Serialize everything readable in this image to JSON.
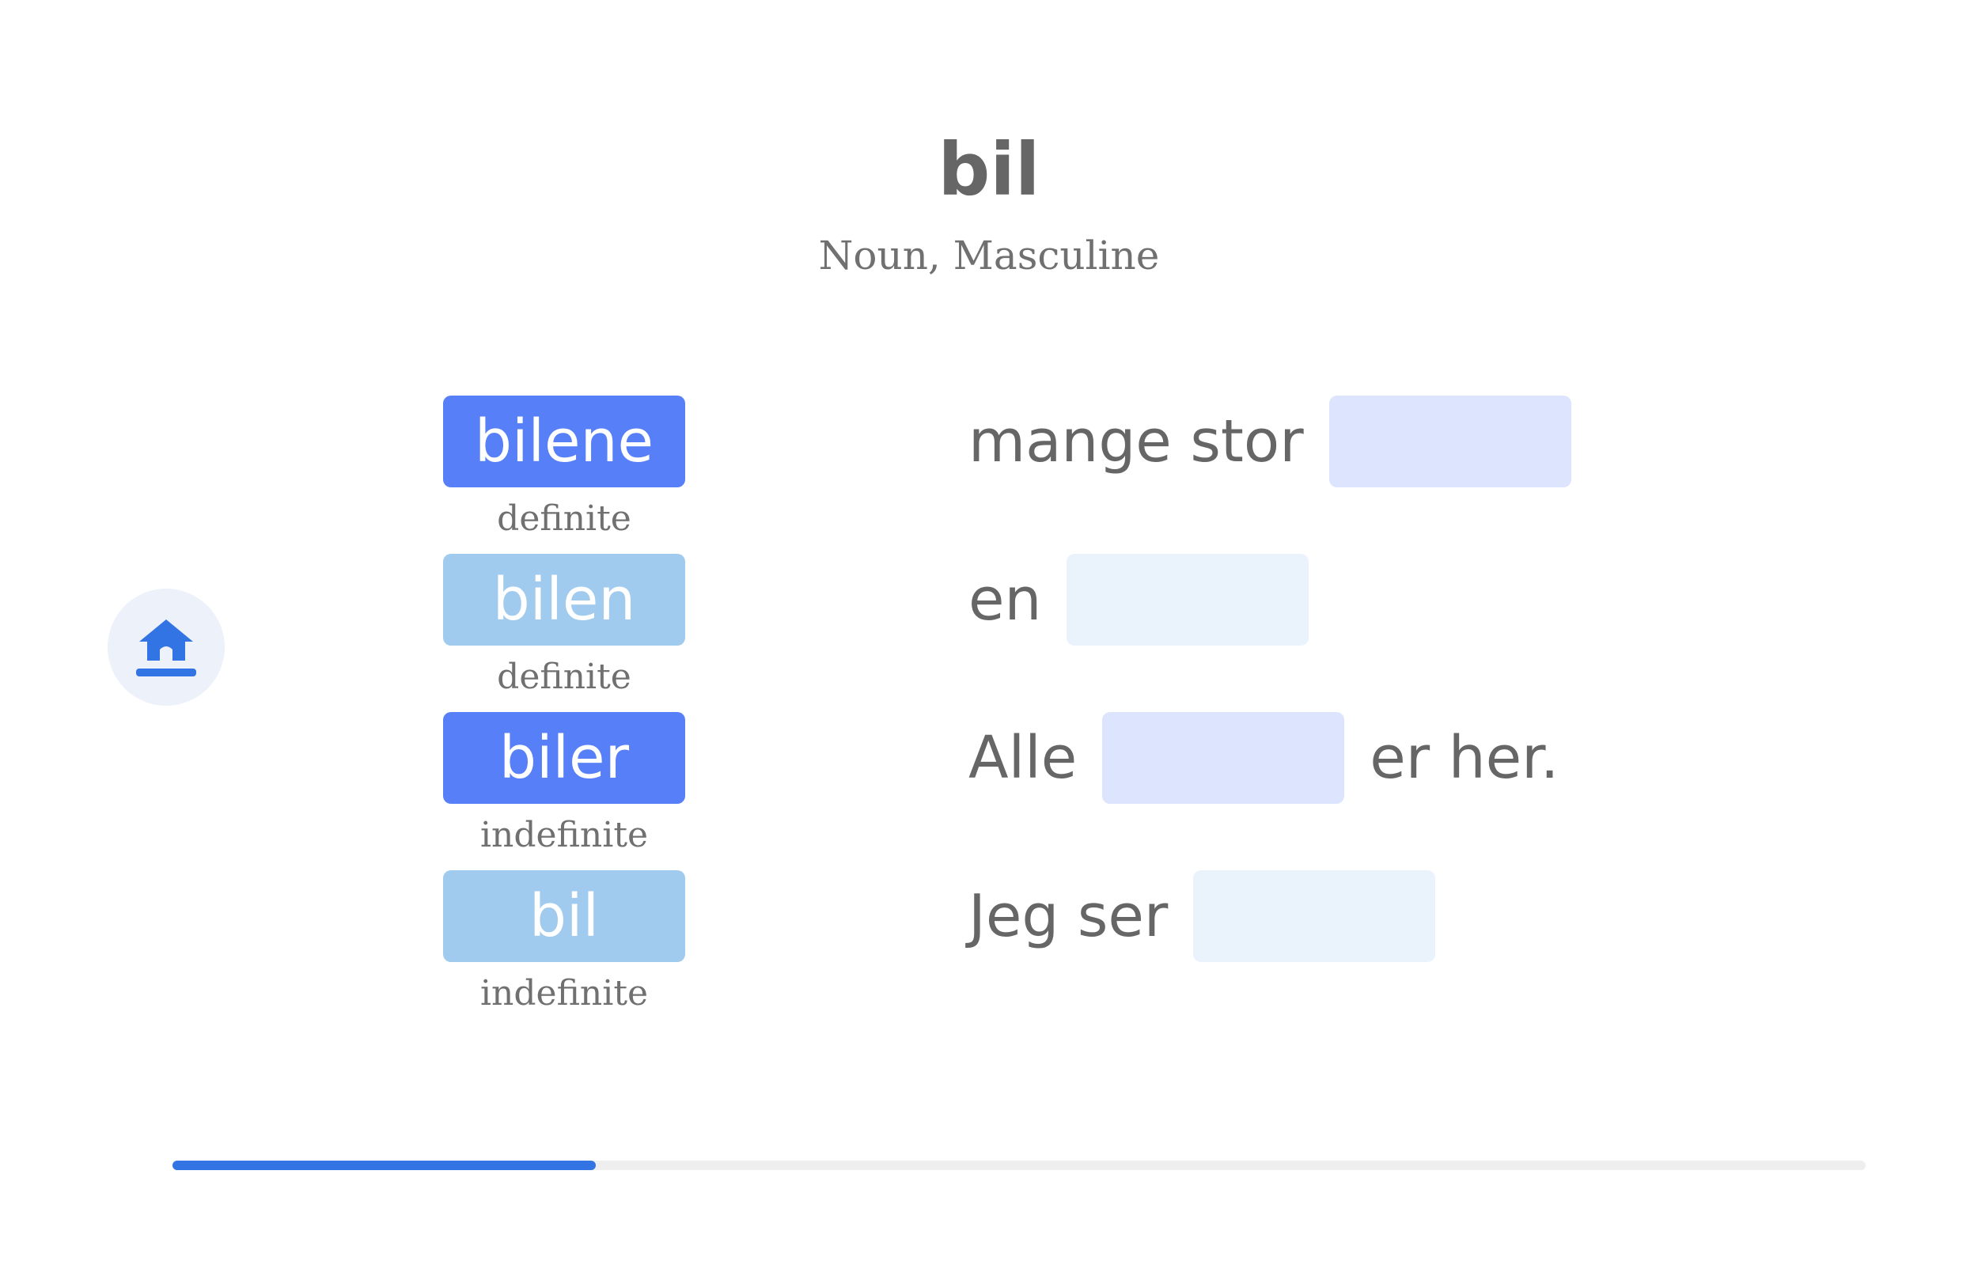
{
  "header": {
    "word": "bil",
    "grammar": "Noun, Masculine"
  },
  "home": {
    "icon": "home-icon",
    "color": "#3374e4"
  },
  "chips": [
    {
      "text": "bilene",
      "label": "definite",
      "style": "dark"
    },
    {
      "text": "bilen",
      "label": "definite",
      "style": "light"
    },
    {
      "text": "biler",
      "label": "indefinite",
      "style": "dark"
    },
    {
      "text": "bil",
      "label": "indefinite",
      "style": "light"
    }
  ],
  "sentences": [
    {
      "before": "mange stor",
      "after": "",
      "slot_color": "purple"
    },
    {
      "before": "en",
      "after": "",
      "slot_color": "pale"
    },
    {
      "before": "Alle",
      "after": "er her.",
      "slot_color": "purple"
    },
    {
      "before": "Jeg ser",
      "after": "",
      "slot_color": "pale"
    }
  ],
  "progress": {
    "fraction": 0.25
  },
  "colors": {
    "chip_dark": "#577ff7",
    "chip_light": "#a1cbee",
    "slot_purple": "#dde4fd",
    "slot_pale": "#eaf3fb",
    "progress": "#3374e4",
    "text": "#666666"
  }
}
